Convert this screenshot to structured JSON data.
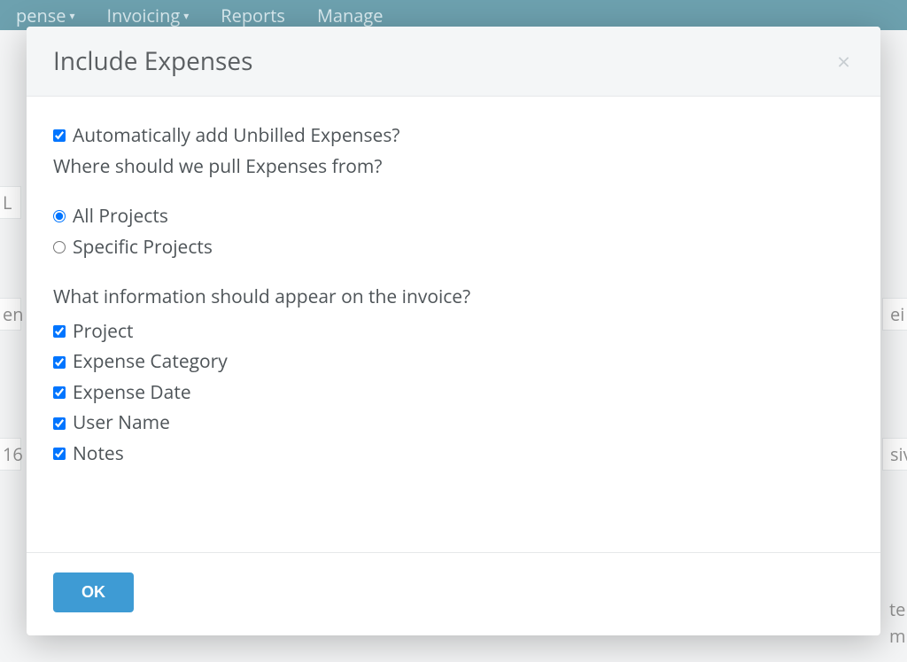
{
  "nav": {
    "items": [
      {
        "label": "pense",
        "has_caret": true
      },
      {
        "label": "Invoicing",
        "has_caret": true
      },
      {
        "label": "Reports",
        "has_caret": false
      },
      {
        "label": "Manage",
        "has_caret": false
      }
    ]
  },
  "bg": {
    "left1": "L",
    "left2": "en",
    "left3": "16",
    "right1": "ei",
    "right2": "siv",
    "right3": "te",
    "right4": "m"
  },
  "modal": {
    "title": "Include Expenses",
    "close_glyph": "×",
    "auto_add": {
      "label": "Automatically add Unbilled Expenses?",
      "checked": true
    },
    "pull_question": "Where should we pull Expenses from?",
    "pull_options": [
      {
        "label": "All Projects",
        "selected": true
      },
      {
        "label": "Specific Projects",
        "selected": false
      }
    ],
    "info_question": "What information should appear on the invoice?",
    "info_options": [
      {
        "label": "Project",
        "checked": true
      },
      {
        "label": "Expense Category",
        "checked": true
      },
      {
        "label": "Expense Date",
        "checked": true
      },
      {
        "label": "User Name",
        "checked": true
      },
      {
        "label": "Notes",
        "checked": true
      }
    ],
    "ok_label": "OK"
  }
}
